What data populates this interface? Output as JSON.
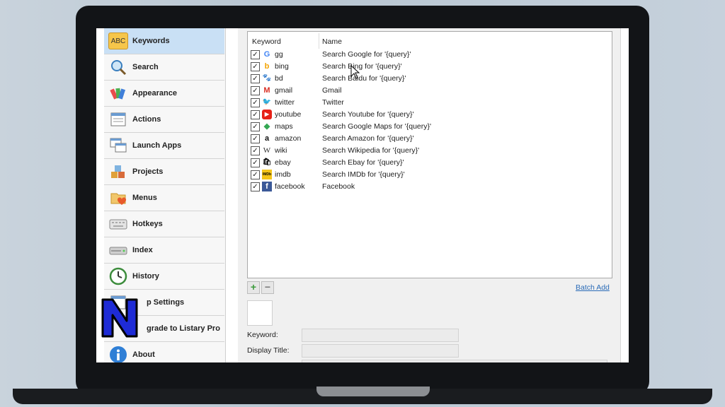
{
  "sidebar": {
    "items": [
      {
        "label": "Keywords",
        "icon": "abc-icon",
        "active": true,
        "glyph": "ABC"
      },
      {
        "label": "Search",
        "icon": "magnifier-icon"
      },
      {
        "label": "Appearance",
        "icon": "palette-icon"
      },
      {
        "label": "Actions",
        "icon": "actions-icon"
      },
      {
        "label": "Launch Apps",
        "icon": "windows-icon"
      },
      {
        "label": "Projects",
        "icon": "cubes-icon"
      },
      {
        "label": "Menus",
        "icon": "folder-heart-icon"
      },
      {
        "label": "Hotkeys",
        "icon": "keyboard-icon"
      },
      {
        "label": "Index",
        "icon": "drive-icon"
      },
      {
        "label": "History",
        "icon": "clock-icon"
      },
      {
        "label": "p Settings",
        "icon": "settings-window-icon"
      },
      {
        "label": "grade to Listary Pro",
        "icon": "upgrade-icon"
      },
      {
        "label": "About",
        "icon": "info-icon"
      }
    ]
  },
  "table": {
    "headers": {
      "keyword": "Keyword",
      "name": "Name"
    },
    "rows": [
      {
        "keyword": "gg",
        "name": "Search Google for '{query}'",
        "icon": "google-icon",
        "glyph": "G",
        "color": "#4285f4"
      },
      {
        "keyword": "bing",
        "name": "Search Bing for '{query}'",
        "icon": "bing-icon",
        "glyph": "b",
        "color": "#f4a300"
      },
      {
        "keyword": "bd",
        "name": "Search Baidu for '{query}'",
        "icon": "baidu-icon",
        "glyph": "🐾",
        "color": "#2932e1"
      },
      {
        "keyword": "gmail",
        "name": "Gmail",
        "icon": "gmail-icon",
        "glyph": "M",
        "color": "#d93025"
      },
      {
        "keyword": "twitter",
        "name": "Twitter",
        "icon": "twitter-icon",
        "glyph": "🐦",
        "color": "#1da1f2"
      },
      {
        "keyword": "youtube",
        "name": "Search Youtube for '{query}'",
        "icon": "youtube-icon",
        "glyph": "▶",
        "color": "#e62117"
      },
      {
        "keyword": "maps",
        "name": "Search Google Maps for '{query}'",
        "icon": "maps-icon",
        "glyph": "◆",
        "color": "#34a853"
      },
      {
        "keyword": "amazon",
        "name": "Search Amazon for '{query}'",
        "icon": "amazon-icon",
        "glyph": "a",
        "color": "#111111"
      },
      {
        "keyword": "wiki",
        "name": "Search Wikipedia for '{query}'",
        "icon": "wikipedia-icon",
        "glyph": "W",
        "color": "#333333"
      },
      {
        "keyword": "ebay",
        "name": "Search Ebay for '{query}'",
        "icon": "ebay-icon",
        "glyph": "🛍",
        "color": "#333333"
      },
      {
        "keyword": "imdb",
        "name": "Search IMDb for '{query}'",
        "icon": "imdb-icon",
        "glyph": "IMDb",
        "color": "#f5c518"
      },
      {
        "keyword": "facebook",
        "name": "Facebook",
        "icon": "facebook-icon",
        "glyph": "f",
        "color": "#3b5998"
      }
    ]
  },
  "toolbar": {
    "add_glyph": "+",
    "remove_glyph": "−",
    "batch_add": "Batch Add"
  },
  "form": {
    "keyword_label": "Keyword:",
    "display_title_label": "Display Title:"
  },
  "colors": {
    "accent_active": "#c9e0f5",
    "link": "#2a6bb7"
  }
}
